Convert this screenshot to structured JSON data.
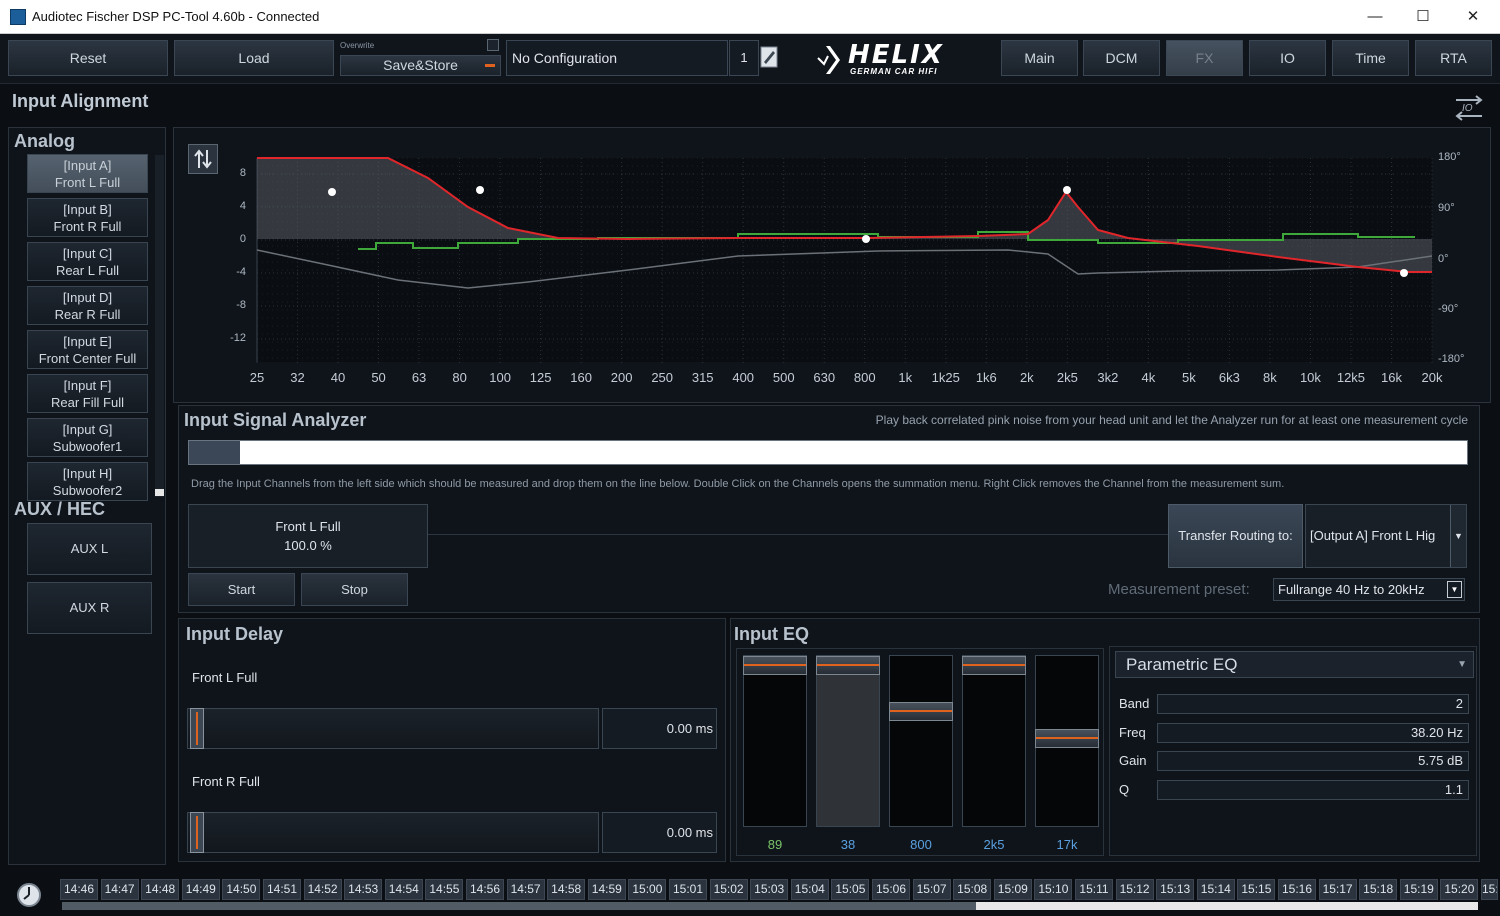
{
  "window": {
    "title": "Audiotec Fischer DSP PC-Tool 4.60b - Connected",
    "minimize": "—",
    "maximize": "☐",
    "close": "✕"
  },
  "toolbar": {
    "reset": "Reset",
    "load": "Load",
    "overwrite": "Overwrite",
    "save_store": "Save&Store",
    "config_name": "No Configuration",
    "config_number": "1",
    "logo_text": "HELIX",
    "logo_sub": "GERMAN CAR HIFI",
    "tabs": [
      "Main",
      "DCM",
      "FX",
      "IO",
      "Time",
      "RTA"
    ],
    "active_tab": "FX"
  },
  "page": {
    "title": "Input Alignment"
  },
  "channels": {
    "analog_title": "Analog",
    "analog": [
      {
        "id": "[Input A]",
        "name": "Front L Full",
        "selected": true
      },
      {
        "id": "[Input B]",
        "name": "Front R Full",
        "selected": false
      },
      {
        "id": "[Input C]",
        "name": "Rear L Full",
        "selected": false
      },
      {
        "id": "[Input D]",
        "name": "Rear R Full",
        "selected": false
      },
      {
        "id": "[Input E]",
        "name": "Front Center Full",
        "selected": false
      },
      {
        "id": "[Input F]",
        "name": "Rear Fill Full",
        "selected": false
      },
      {
        "id": "[Input G]",
        "name": "Subwoofer1",
        "selected": false
      },
      {
        "id": "[Input H]",
        "name": "Subwoofer2",
        "selected": false
      }
    ],
    "aux_title": "AUX / HEC",
    "aux": [
      "AUX L",
      "AUX R"
    ]
  },
  "chart": {
    "freq_labels": [
      "25",
      "32",
      "40",
      "50",
      "63",
      "80",
      "100",
      "125",
      "160",
      "200",
      "250",
      "315",
      "400",
      "500",
      "630",
      "800",
      "1k",
      "1k25",
      "1k6",
      "2k",
      "2k5",
      "3k2",
      "4k",
      "5k",
      "6k3",
      "8k",
      "10k",
      "12k5",
      "16k",
      "20k"
    ],
    "db_labels": [
      "8",
      "4",
      "0",
      "-4",
      "-8",
      "-12"
    ],
    "phase_labels": [
      "180°",
      "90°",
      "0°",
      "-90°",
      "-180°"
    ],
    "colors": {
      "response": "#e0262b",
      "measured": "#3fa83a",
      "phase": "#6b7178"
    }
  },
  "analyzer": {
    "title": "Input Signal Analyzer",
    "hint": "Play back correlated pink noise from your head unit and let the Analyzer run for at least one measurement cycle",
    "progress": 0.04,
    "drag_hint": "Drag the Input Channels from the left side which should be measured and drop them on the line below. Double Click on the Channels opens the summation menu. Right Click removes the Channel from the measurement sum.",
    "sum_channel": "Front L Full",
    "sum_percent": "100.0 %",
    "start": "Start",
    "stop": "Stop",
    "transfer": "Transfer Routing to:",
    "routing_target": "[Output A] Front L Hig",
    "measurement_label": "Measurement preset:",
    "measurement_preset": "Fullrange 40 Hz to 20kHz"
  },
  "delay": {
    "title": "Input Delay",
    "channels": [
      {
        "name": "Front L Full",
        "value": "0.00 ms"
      },
      {
        "name": "Front R Full",
        "value": "0.00 ms"
      }
    ]
  },
  "eq": {
    "title": "Input EQ",
    "bands": [
      {
        "freq": "89",
        "gain_fraction": 0.0
      },
      {
        "freq": "38",
        "gain_fraction": 0.0
      },
      {
        "freq": "800",
        "gain_fraction": 0.3
      },
      {
        "freq": "2k5",
        "gain_fraction": 0.0
      },
      {
        "freq": "17k",
        "gain_fraction": 0.48
      }
    ],
    "selected_band_index": 1,
    "mode": "Parametric EQ",
    "fields": [
      {
        "label": "Band",
        "value": "2"
      },
      {
        "label": "Freq",
        "value": "38.20 Hz"
      },
      {
        "label": "Gain",
        "value": "5.75 dB"
      },
      {
        "label": "Q",
        "value": "1.1"
      }
    ]
  },
  "timeline": {
    "times": [
      "14:46",
      "14:47",
      "14:48",
      "14:49",
      "14:50",
      "14:51",
      "14:52",
      "14:53",
      "14:54",
      "14:55",
      "14:56",
      "14:57",
      "14:58",
      "14:59",
      "15:00",
      "15:01",
      "15:02",
      "15:03",
      "15:04",
      "15:05",
      "15:06",
      "15:07",
      "15:08",
      "15:09",
      "15:10",
      "15:11",
      "15:12",
      "15:13",
      "15:14",
      "15:15",
      "15:16",
      "15:17",
      "15:18",
      "15:19",
      "15:20",
      "15:"
    ]
  }
}
